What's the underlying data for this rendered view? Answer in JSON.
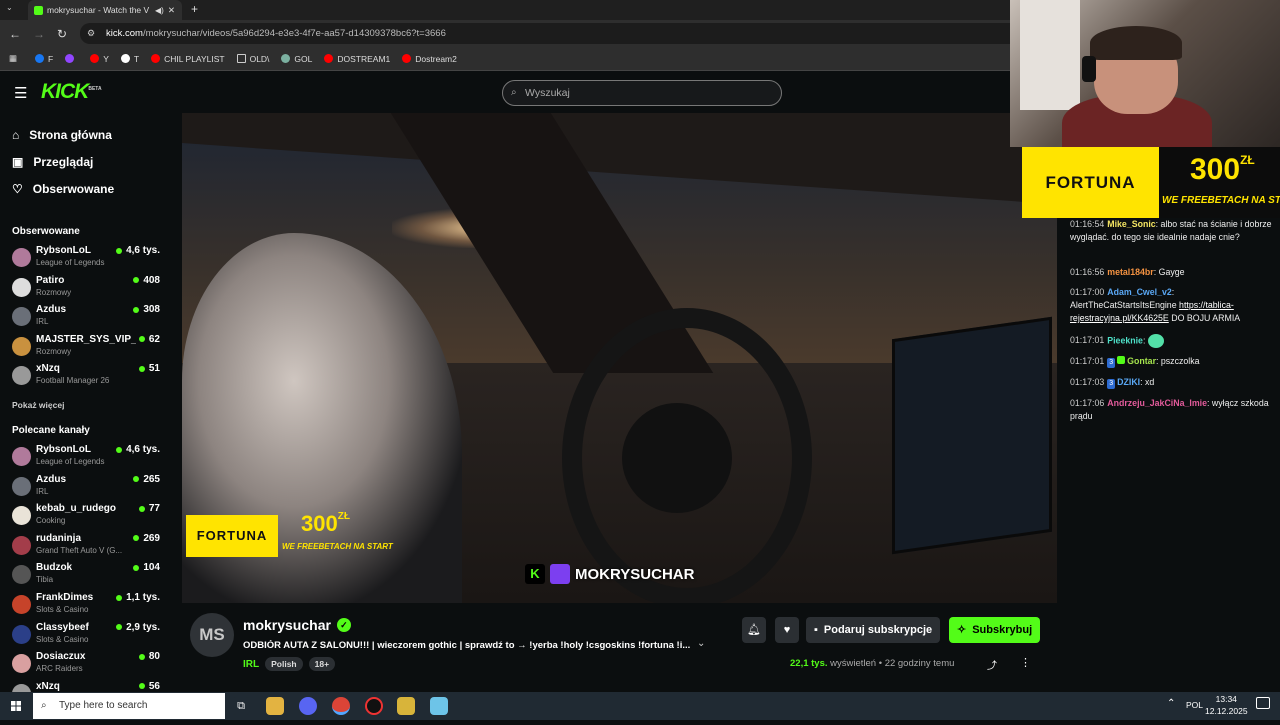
{
  "browser": {
    "tab_title": "mokrysuchar - Watch the V",
    "url_host": "kick.com",
    "url_path": "/mokrysuchar/videos/5a96d294-e3e3-4f7e-aa57-d14309378bc6?t=3666",
    "bookmarks": [
      {
        "label": "F",
        "color": "#1877f2"
      },
      {
        "label": "",
        "color": "#9146ff"
      },
      {
        "label": "Y",
        "color": "#ff0000"
      },
      {
        "label": "T",
        "color": "#ffffff"
      },
      {
        "label": "CHIL PLAYLIST",
        "color": "#ff0000"
      },
      {
        "label": "OLD\\",
        "color": "folder"
      },
      {
        "label": "GOL",
        "color": "#7bb0a0"
      },
      {
        "label": "DOSTREAM1",
        "color": "#ff0000"
      },
      {
        "label": "Dostream2",
        "color": "#ff0000"
      }
    ]
  },
  "header": {
    "logo": "KICK",
    "logo_beta": "BETA",
    "search_placeholder": "Wyszukaj"
  },
  "sidebar": {
    "nav": [
      {
        "label": "Strona główna",
        "icon": "home-icon"
      },
      {
        "label": "Przeglądaj",
        "icon": "browse-icon"
      },
      {
        "label": "Obserwowane",
        "icon": "heart-icon"
      }
    ],
    "followed_heading": "Obserwowane",
    "followed": [
      {
        "name": "RybsonLoL",
        "category": "League of Legends",
        "viewers": "4,6 tys.",
        "color": "#b07a9b"
      },
      {
        "name": "Patiro",
        "category": "Rozmowy",
        "viewers": "408",
        "color": "#ddd"
      },
      {
        "name": "Azdus",
        "category": "IRL",
        "viewers": "308",
        "color": "#6a6f78"
      },
      {
        "name": "MAJSTER_SYS_VIP_C",
        "category": "Rozmowy",
        "viewers": "62",
        "color": "#c9913f"
      },
      {
        "name": "xNzq",
        "category": "Football Manager 26",
        "viewers": "51",
        "color": "#999"
      }
    ],
    "show_more": "Pokaż więcej",
    "recommended_heading": "Polecane kanały",
    "recommended": [
      {
        "name": "RybsonLoL",
        "category": "League of Legends",
        "viewers": "4,6 tys.",
        "color": "#b07a9b"
      },
      {
        "name": "Azdus",
        "category": "IRL",
        "viewers": "265",
        "color": "#6a6f78"
      },
      {
        "name": "kebab_u_rudego",
        "category": "Cooking",
        "viewers": "77",
        "color": "#e9e3d8"
      },
      {
        "name": "rudaninja",
        "category": "Grand Theft Auto V (G...",
        "viewers": "269",
        "color": "#a33d4a"
      },
      {
        "name": "Budzok",
        "category": "Tibia",
        "viewers": "104",
        "color": "#555"
      },
      {
        "name": "FrankDimes",
        "category": "Slots & Casino",
        "viewers": "1,1 tys.",
        "color": "#c6432a"
      },
      {
        "name": "Classybeef",
        "category": "Slots & Casino",
        "viewers": "2,9 tys.",
        "color": "#2b3f88"
      },
      {
        "name": "Dosiaczux",
        "category": "ARC Raiders",
        "viewers": "80",
        "color": "#d9a0a0"
      },
      {
        "name": "xNzq",
        "category": "",
        "viewers": "56",
        "color": "#999"
      }
    ]
  },
  "video": {
    "ad_brand": "FORTUNA",
    "ad_amount": "300",
    "ad_currency": "ZŁ",
    "ad_sub": "WE FREEBETACH NA START",
    "watermark": "MOKRYSUCHAR"
  },
  "stream": {
    "avatar_initials": "MS",
    "streamer": "mokrysuchar",
    "title": "ODBIÓR AUTA Z SALONU!!! | wieczorem gothic | sprawdź to → !yerba !holy !csgoskins !fortuna !i...",
    "category": "IRL",
    "tags": [
      "Polish",
      "18+"
    ],
    "gift_label": "Podaruj subskrypcje",
    "subscribe_label": "Subskrybuj",
    "views": "22,1 tys.",
    "views_label": "wyświetleń",
    "separator": "•",
    "ago": "22 godziny temu"
  },
  "banner": {
    "brand": "FORTUNA",
    "amount": "300",
    "currency": "ZŁ",
    "sub": "WE FREEBETACH NA START"
  },
  "chat": [
    {
      "time": "01:16:54",
      "user": "Mike_Sonic",
      "color": "#f5e663",
      "text": "albo stać na ścianie i dobrze wyglądać. do tego sie idealnie nadaje cnie?",
      "badge": "",
      "gift": false
    },
    {
      "time": "01:16:56",
      "user": "metal184br",
      "color": "#f59342",
      "text": "Gayge",
      "badge": "",
      "gift": false
    },
    {
      "time": "01:17:00",
      "user": "Adam_Cwel_v2",
      "color": "#5aa8f5",
      "text": "AlertTheCatStartsItsEngine",
      "link": "https://tablica-rejestracyjna.pl/KK4625E",
      "text2": "DO BOJU ARMIA",
      "badge": "",
      "gift": false
    },
    {
      "time": "01:17:01",
      "user": "Pieeknie",
      "color": "#4ee1c9",
      "text": "",
      "badge": "",
      "gift": false
    },
    {
      "time": "01:17:01",
      "user": "Gontar",
      "color": "#a4e34d",
      "text": "pszczolka",
      "badge": "3",
      "gift": true
    },
    {
      "time": "01:17:03",
      "user": "DZIKI",
      "color": "#5aa8f5",
      "text": "xd",
      "badge": "3",
      "gift": false
    },
    {
      "time": "01:17:06",
      "user": "Andrzeju_JakCiNa_Imie",
      "color": "#e35b9b",
      "text": "wyłącz szkoda prądu",
      "badge": "",
      "gift": false
    }
  ],
  "taskbar": {
    "search_placeholder": "Type here to search",
    "lang": "POL",
    "time": "13:34",
    "date": "12.12.2025"
  }
}
